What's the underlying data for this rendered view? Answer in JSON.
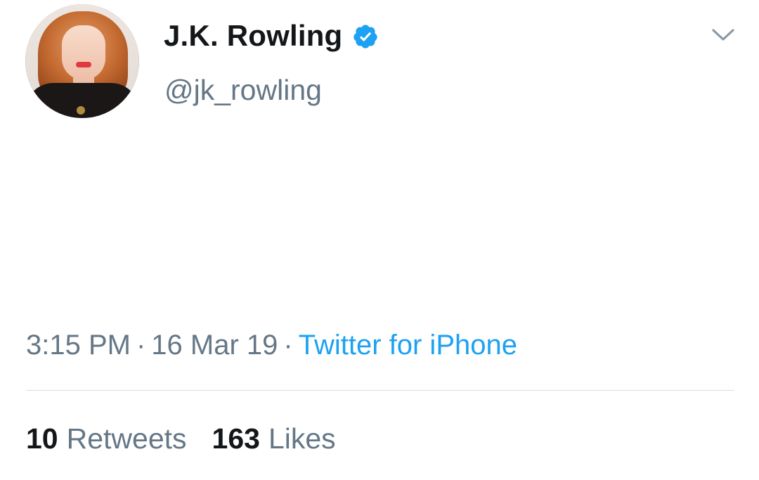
{
  "tweet": {
    "author": {
      "display_name": "J.K. Rowling",
      "handle": "@jk_rowling",
      "verified": true,
      "avatar_icon": "profile-photo"
    },
    "menu_icon": "chevron-down-icon",
    "meta": {
      "time": "3:15 PM",
      "separator": "·",
      "date": "16 Mar 19",
      "source": "Twitter for iPhone"
    },
    "stats": {
      "retweets_count": "10",
      "retweets_label": "Retweets",
      "likes_count": "163",
      "likes_label": "Likes"
    }
  },
  "colors": {
    "primary_text": "#14171a",
    "secondary_text": "#657786",
    "link_blue": "#1da1f2",
    "divider": "#d8dde2",
    "verified_badge": "#1da1f2"
  }
}
